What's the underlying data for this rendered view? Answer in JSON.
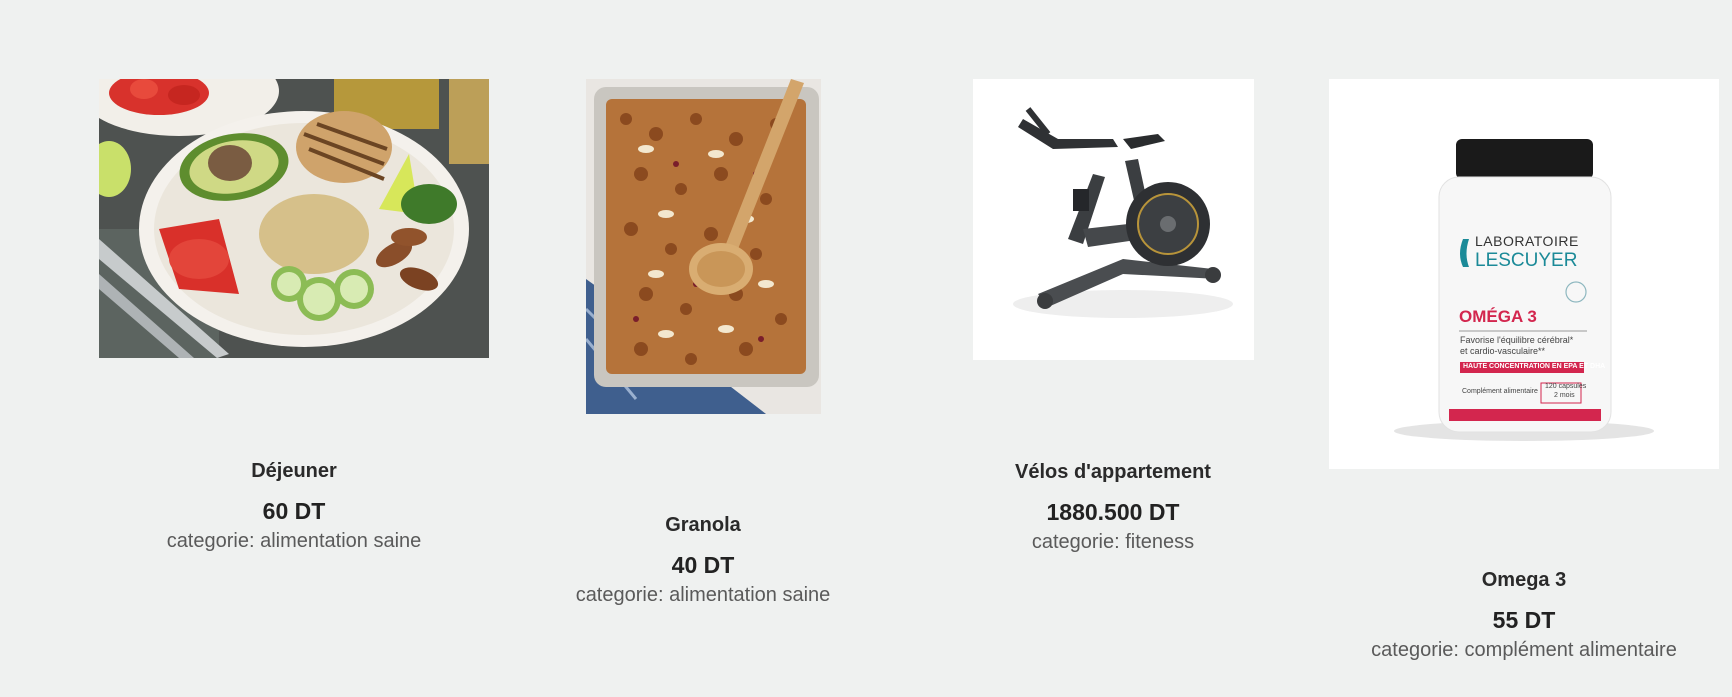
{
  "products": [
    {
      "name": "Déjeuner",
      "price": "60 DT",
      "category": "categorie: alimentation saine",
      "image_icon": "healthy-bowl-image"
    },
    {
      "name": "Granola",
      "price": "40 DT",
      "category": "categorie: alimentation saine",
      "image_icon": "granola-tray-image"
    },
    {
      "name": "Vélos d'appartement",
      "price": "1880.500 DT",
      "category": "categorie: fiteness",
      "image_icon": "exercise-bike-image"
    },
    {
      "name": "Omega 3",
      "price": "55 DT",
      "category": "categorie: complément alimentaire",
      "image_icon": "supplement-bottle-image",
      "label": {
        "brand_top": "LABORATOIRE",
        "brand_bottom": "LESCUYER",
        "product": "OMÉGA 3",
        "desc1": "Favorise l'équilibre cérébral*",
        "desc2": "et cardio-vasculaire**",
        "band": "HAUTE CONCENTRATION EN EPA ET DHA",
        "foot_left": "Complément alimentaire",
        "foot_right1": "120 capsules",
        "foot_right2": "2 mois"
      }
    }
  ],
  "colors": {
    "background": "#eff1f0",
    "accent_red": "#d3264e",
    "teal": "#1b8a98"
  }
}
